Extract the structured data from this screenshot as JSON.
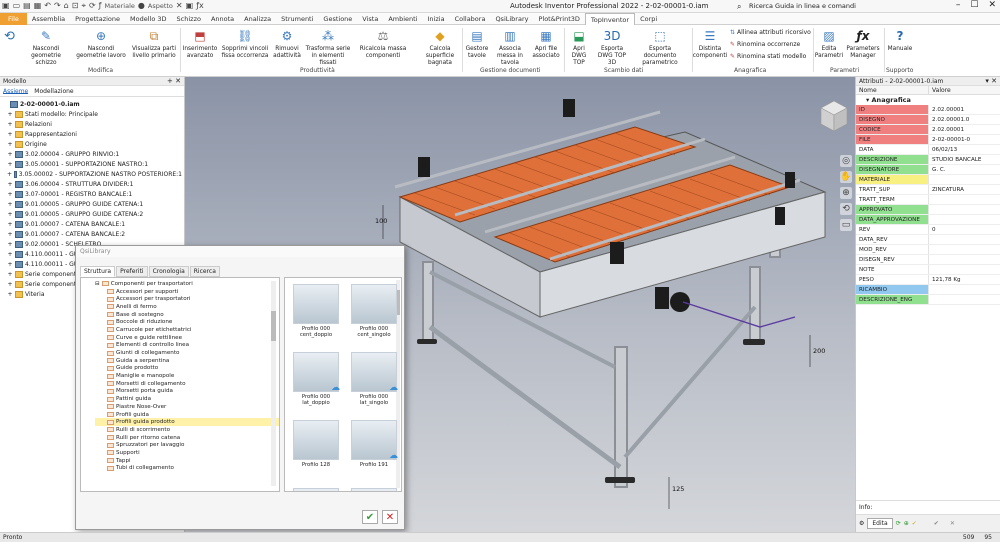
{
  "titlebar": {
    "title": "Autodesk Inventor Professional 2022 - 2-02-00001-0.iam",
    "qat_material": "Materiale",
    "qat_appearance": "Aspetto",
    "search_placeholder": "Ricerca Guida in linea e comandi"
  },
  "tabs": [
    "File",
    "Assemblia",
    "Progettazione",
    "Modello 3D",
    "Schizzo",
    "Annota",
    "Analizza",
    "Strumenti",
    "Gestione",
    "Vista",
    "Ambienti",
    "Inizia",
    "Collabora",
    "QsiLibrary",
    "Plot&Print3D",
    "TopInventor",
    "Corpi"
  ],
  "active_tab_index": 15,
  "ribbon": {
    "buttons": [
      {
        "label": "Nascondi geometrie schizzo",
        "icon": "sketch-hide-icon"
      },
      {
        "label": "Nascondi geometrie lavoro",
        "icon": "work-hide-icon"
      },
      {
        "label": "Visualizza parti livello primario",
        "icon": "parts-view-icon"
      },
      {
        "label": "Inserimento avanzato",
        "icon": "insert-icon"
      },
      {
        "label": "Sopprimi vincoli fissa occorrenza",
        "icon": "constraint-icon"
      },
      {
        "label": "Rimuovi adattività",
        "icon": "adaptive-icon"
      },
      {
        "label": "Trasforma serie in elementi fissati",
        "icon": "pattern-icon"
      },
      {
        "label": "Ricalcola massa componenti",
        "icon": "mass-icon"
      },
      {
        "label": "Calcola superficie bagnata",
        "icon": "surface-icon"
      },
      {
        "label": "Gestore tavole",
        "icon": "sheets-icon"
      },
      {
        "label": "Associa messa in tavola",
        "icon": "associate-icon"
      },
      {
        "label": "Apri file associato",
        "icon": "open-file-icon"
      },
      {
        "label": "Apri DWG TOP",
        "icon": "dwg-open-icon"
      },
      {
        "label": "Esporta DWG TOP 3D",
        "icon": "dwg-export-icon"
      },
      {
        "label": "Esporta documento parametrico",
        "icon": "export-doc-icon"
      },
      {
        "label": "Distinta componenti",
        "icon": "bom-icon"
      },
      {
        "label": "Edita Parametri",
        "icon": "edit-params-icon"
      },
      {
        "label": "Parameters Manager",
        "icon": "fx-icon"
      },
      {
        "label": "Manuale",
        "icon": "help-icon"
      }
    ],
    "small_buttons": [
      "Allinea attributi ricorsivo",
      "Rinomina occorrenze",
      "Rinomina stati modello"
    ],
    "groups": [
      "Modifica",
      "Produttività",
      "Gestione documenti",
      "Scambio dati",
      "Anagrafica",
      "Parametri",
      "Supporto"
    ]
  },
  "left_panel": {
    "header": "Modello",
    "tabs": [
      "Assieme",
      "Modellazione"
    ],
    "tree": [
      {
        "label": "2-02-00001-0.iam",
        "type": "asm",
        "level": 0,
        "toggle": ""
      },
      {
        "label": "Stati modello: Principale",
        "type": "folder",
        "level": 1,
        "toggle": "+"
      },
      {
        "label": "Relazioni",
        "type": "folder",
        "level": 1,
        "toggle": "+"
      },
      {
        "label": "Rappresentazioni",
        "type": "folder",
        "level": 1,
        "toggle": "+"
      },
      {
        "label": "Origine",
        "type": "folder",
        "level": 1,
        "toggle": "+"
      },
      {
        "label": "3.02.00004 - GRUPPO RINVIO:1",
        "type": "asm",
        "level": 1,
        "toggle": "+"
      },
      {
        "label": "3.05.00001 - SUPPORTAZIONE NASTRO:1",
        "type": "asm",
        "level": 1,
        "toggle": "+"
      },
      {
        "label": "3.05.00002 - SUPPORTAZIONE NASTRO POSTERIORE:1",
        "type": "asm",
        "level": 1,
        "toggle": "+"
      },
      {
        "label": "3.06.00004 - STRUTTURA DIVIDER:1",
        "type": "asm",
        "level": 1,
        "toggle": "+"
      },
      {
        "label": "3.07-00001 - REGISTRO BANCALE:1",
        "type": "asm",
        "level": 1,
        "toggle": "+"
      },
      {
        "label": "9.01.00005 - GRUPPO GUIDE CATENA:1",
        "type": "asm",
        "level": 1,
        "toggle": "+"
      },
      {
        "label": "9.01.00005 - GRUPPO GUIDE CATENA:2",
        "type": "asm",
        "level": 1,
        "toggle": "+"
      },
      {
        "label": "9.01.00007 - CATENA BANCALE:1",
        "type": "asm",
        "level": 1,
        "toggle": "+"
      },
      {
        "label": "9.01.00007 - CATENA BANCALE:2",
        "type": "asm",
        "level": 1,
        "toggle": "+"
      },
      {
        "label": "9.02.00001 - SCHELETRO",
        "type": "asm",
        "level": 1,
        "toggle": "+"
      },
      {
        "label": "4.110.00011 - GUIDA",
        "type": "asm",
        "level": 1,
        "toggle": "+"
      },
      {
        "label": "4.110.00011 - GUIDA",
        "type": "asm",
        "level": 1,
        "toggle": "+"
      },
      {
        "label": "Serie componente 1:1",
        "type": "folder",
        "level": 1,
        "toggle": "+"
      },
      {
        "label": "Serie componente 2:1",
        "type": "folder",
        "level": 1,
        "toggle": "+"
      },
      {
        "label": "Viteria",
        "type": "folder",
        "level": 1,
        "toggle": "+"
      }
    ]
  },
  "viewport": {
    "dimensions": [
      "100",
      "200",
      "125"
    ]
  },
  "dialog": {
    "title": "QsiLibrary",
    "tabs": [
      "Struttura",
      "Preferiti",
      "Cronologia",
      "Ricerca"
    ],
    "root": "Componenti per trasportatori",
    "items": [
      "Accessori per supporti",
      "Accessori per trasportatori",
      "Anelli di fermo",
      "Base di sostegno",
      "Boccole di riduzione",
      "Carrucole per etichettatrici",
      "Curve e guide rettilinee",
      "Elementi di controllo linea",
      "Giunti di collegamento",
      "Guida a serpentina",
      "Guide prodotto",
      "Maniglie e manopole",
      "Morsetti di collegamento",
      "Morsetti porta guida",
      "Pattini guida",
      "Piastre Nose-Over",
      "Profili guida",
      "Profili guida prodotto",
      "Rulli di scorrimento",
      "Rulli per ritorno catena",
      "Spruzzatori per lavaggio",
      "Supporti",
      "Tappi",
      "Tubi di collegamento"
    ],
    "selected_item_index": 17,
    "grid": [
      {
        "label": "Profilo 000 cent_doppio",
        "cloud": false
      },
      {
        "label": "Profilo 000 cent_singolo",
        "cloud": false
      },
      {
        "label": "Profilo 000 lat_doppio",
        "cloud": true
      },
      {
        "label": "Profilo 000 lat_singolo",
        "cloud": true
      },
      {
        "label": "Profilo 128",
        "cloud": false
      },
      {
        "label": "Profilo 191",
        "cloud": true
      }
    ]
  },
  "right_panel": {
    "header": "Attributi - 2-02-00001-0.iam",
    "col_name": "Nome",
    "col_value": "Valore",
    "group": "Anagrafica",
    "rows": [
      {
        "name": "ID",
        "value": "2.02.00001",
        "color": "#f08080"
      },
      {
        "name": "DISEGNO",
        "value": "2.02.00001.0",
        "color": "#f08080"
      },
      {
        "name": "CODICE",
        "value": "2.02.00001",
        "color": "#f08080"
      },
      {
        "name": "FILE",
        "value": "2-02-00001-0",
        "color": "#f08080"
      },
      {
        "name": "DATA",
        "value": "06/02/13",
        "color": "#ffffff"
      },
      {
        "name": "DESCRIZIONE",
        "value": "STUDIO BANCALE",
        "color": "#90e090"
      },
      {
        "name": "DISEGNATORE",
        "value": "G. C.",
        "color": "#90e090"
      },
      {
        "name": "MATERIALE",
        "value": "",
        "color": "#f8f080"
      },
      {
        "name": "TRATT_SUP",
        "value": "ZINCATURA",
        "color": "#ffffff"
      },
      {
        "name": "TRATT_TERM",
        "value": "",
        "color": "#ffffff"
      },
      {
        "name": "APPROVATO",
        "value": "",
        "color": "#90e090"
      },
      {
        "name": "DATA_APPROVAZIONE",
        "value": "",
        "color": "#90e090"
      },
      {
        "name": "REV",
        "value": "0",
        "color": "#ffffff"
      },
      {
        "name": "DATA_REV",
        "value": "",
        "color": "#ffffff"
      },
      {
        "name": "MOD_REV",
        "value": "",
        "color": "#ffffff"
      },
      {
        "name": "DISEGN_REV",
        "value": "",
        "color": "#ffffff"
      },
      {
        "name": "NOTE",
        "value": "",
        "color": "#ffffff"
      },
      {
        "name": "PESO",
        "value": "121,78 Kg",
        "color": "#ffffff"
      },
      {
        "name": "RICAMBIO",
        "value": "",
        "color": "#90c8f0"
      },
      {
        "name": "DESCRIZIONE_ENG",
        "value": "",
        "color": "#90e090"
      }
    ],
    "info_label": "Info:",
    "edit_label": "Edita"
  },
  "statusbar": {
    "text": "Pronto",
    "num1": "509",
    "num2": "95"
  }
}
